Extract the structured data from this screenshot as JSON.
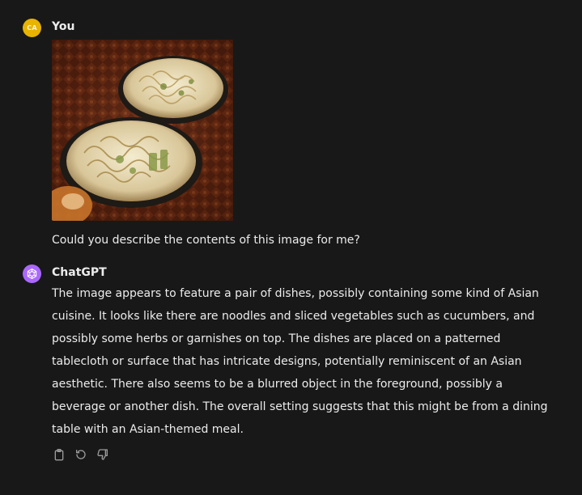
{
  "user": {
    "initials": "CA",
    "name": "You",
    "image_alt": "photo-of-dishes",
    "message": "Could you describe the contents of this image for me?"
  },
  "assistant": {
    "name": "ChatGPT",
    "message": "The image appears to feature a pair of dishes, possibly containing some kind of Asian cuisine. It looks like there are noodles and sliced vegetables such as cucumbers, and possibly some herbs or garnishes on top. The dishes are placed on a patterned tablecloth or surface that has intricate designs, potentially reminiscent of an Asian aesthetic. There also seems to be a blurred object in the foreground, possibly a beverage or another dish. The overall setting suggests that this might be from a dining table with an Asian-themed meal."
  },
  "actions": [
    {
      "icon": "clipboard-icon"
    },
    {
      "icon": "regenerate-icon"
    },
    {
      "icon": "thumbs-down-icon"
    }
  ],
  "colors": {
    "background": "#181818",
    "user_avatar": "#e8b400",
    "bot_avatar": "#ab68ff",
    "text": "#ececec",
    "icon": "#9b9b9b"
  }
}
